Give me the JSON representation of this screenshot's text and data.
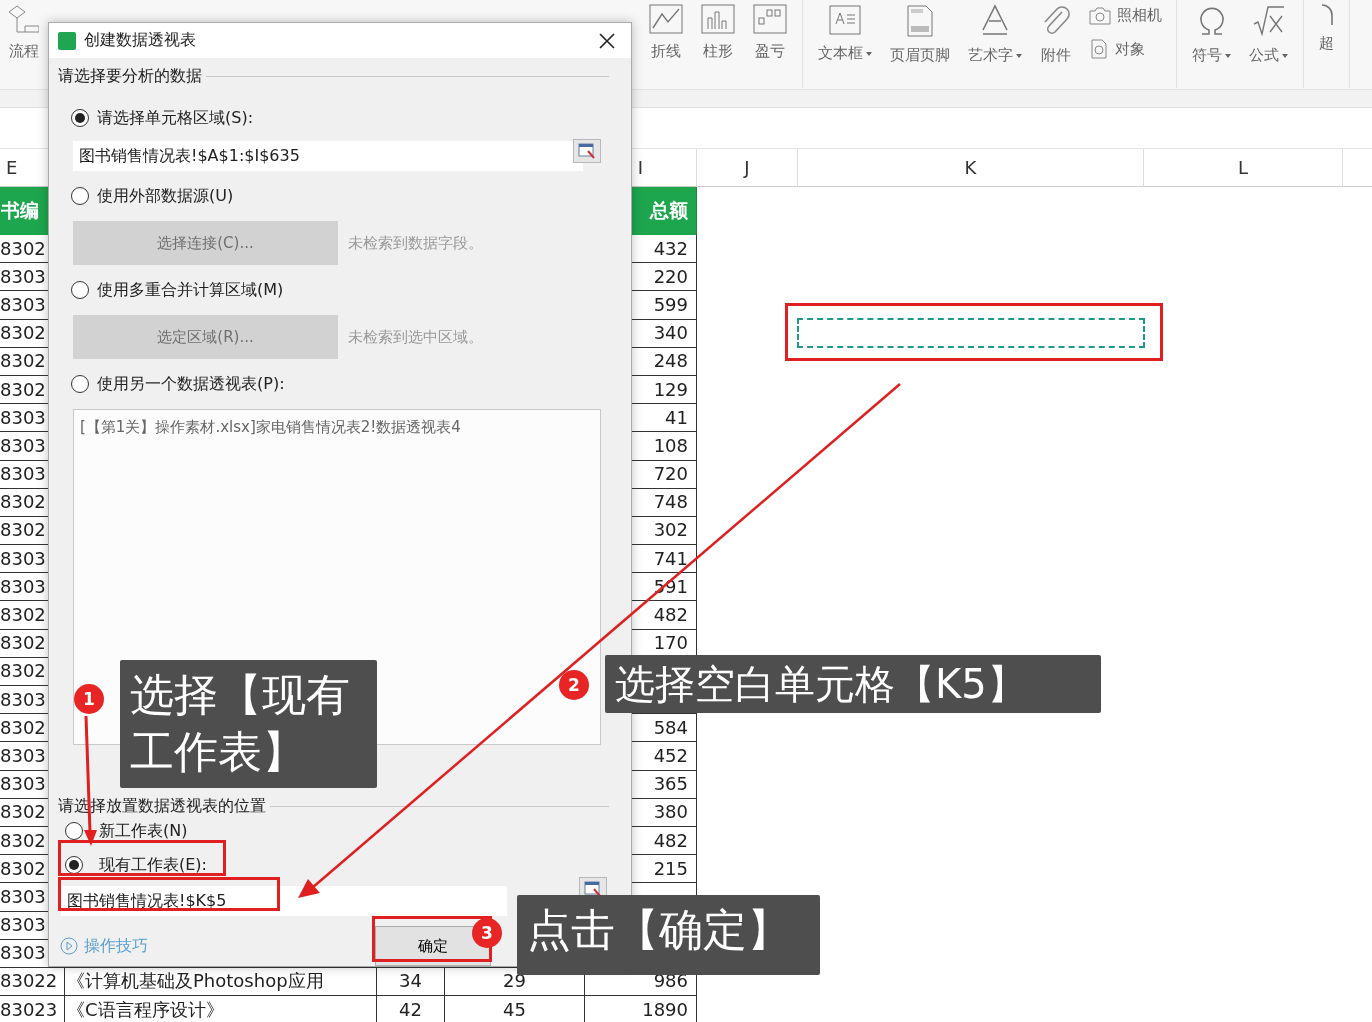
{
  "ribbon": {
    "left_items": [
      {
        "label": "流程"
      }
    ],
    "groups": [
      {
        "items": [
          {
            "kind": "large",
            "label": "折线"
          },
          {
            "kind": "large",
            "label": "柱形"
          },
          {
            "kind": "large",
            "label": "盈亏"
          }
        ]
      },
      {
        "items": [
          {
            "kind": "large",
            "label": "文本框",
            "dropdown": true
          },
          {
            "kind": "large",
            "label": "页眉页脚"
          },
          {
            "kind": "large",
            "label": "艺术字",
            "dropdown": true
          },
          {
            "kind": "large",
            "label": "附件"
          },
          {
            "kind": "stack",
            "entries": [
              {
                "label": "照相机"
              },
              {
                "label": "对象"
              }
            ]
          }
        ]
      },
      {
        "items": [
          {
            "kind": "large",
            "label": "符号",
            "dropdown": true
          },
          {
            "kind": "large",
            "label": "公式",
            "dropdown": true
          }
        ]
      },
      {
        "items": [
          {
            "kind": "large",
            "label": "超"
          }
        ]
      }
    ]
  },
  "sheet": {
    "column_headers": [
      "E",
      "I",
      "J",
      "K",
      "L"
    ],
    "header_cells": {
      "book_id": "书编",
      "total": "总额"
    },
    "rows": [
      {
        "book_id": "8302",
        "total": "432"
      },
      {
        "book_id": "8303",
        "total": "220"
      },
      {
        "book_id": "8303",
        "total": "599"
      },
      {
        "book_id": "8302",
        "total": "340"
      },
      {
        "book_id": "8302",
        "total": "248"
      },
      {
        "book_id": "8302",
        "total": "129"
      },
      {
        "book_id": "8303",
        "total": "41"
      },
      {
        "book_id": "8303",
        "total": "108"
      },
      {
        "book_id": "8303",
        "total": "720"
      },
      {
        "book_id": "8302",
        "total": "748"
      },
      {
        "book_id": "8302",
        "total": "302"
      },
      {
        "book_id": "8303",
        "total": "741"
      },
      {
        "book_id": "8303",
        "total": "591"
      },
      {
        "book_id": "8302",
        "total": "482"
      },
      {
        "book_id": "8302",
        "total": "170"
      },
      {
        "book_id": "8302"
      },
      {
        "book_id": "8303"
      },
      {
        "book_id": "8302",
        "total": "584"
      },
      {
        "book_id": "8303",
        "total": "452"
      },
      {
        "book_id": "8303",
        "total": "365"
      },
      {
        "book_id": "8302",
        "total": "380"
      },
      {
        "book_id": "8302",
        "total": "482"
      },
      {
        "book_id": "8302",
        "total": "215"
      },
      {
        "book_id": "8303"
      },
      {
        "book_id": "8303"
      },
      {
        "book_id": "8303"
      },
      {
        "book_id": "83022",
        "title": "《计算机基础及Photoshop应用",
        "column_g": "34",
        "column_h": "29",
        "total": "986"
      },
      {
        "book_id": "83023",
        "title": "《C语言程序设计》",
        "column_g": "42",
        "column_h": "45",
        "total": "1890"
      }
    ]
  },
  "dialog": {
    "title": "创建数据透视表",
    "source_section": {
      "label": "请选择要分析的数据",
      "options": [
        {
          "kind": "range",
          "label": "请选择单元格区域(S):",
          "selected": true,
          "value": "图书销售情况表!$A$1:$I$635"
        },
        {
          "kind": "connection",
          "label": "使用外部数据源(U)",
          "selected": false,
          "button": "选择连接(C)...",
          "disabled": true,
          "note": "未检索到数据字段。"
        },
        {
          "kind": "connection",
          "label": "使用多重合并计算区域(M)",
          "selected": false,
          "button": "选定区域(R)...",
          "disabled": true,
          "note": "未检索到选中区域。"
        },
        {
          "kind": "list",
          "label": "使用另一个数据透视表(P):",
          "selected": false,
          "items": [
            "[【第1关】操作素材.xlsx]家电销售情况表2!数据透视表4"
          ]
        }
      ]
    },
    "placement_section": {
      "label": "请选择放置数据透视表的位置",
      "options": [
        {
          "kind": "plain",
          "label": "新工作表(N)",
          "selected": false
        },
        {
          "kind": "range",
          "label": "现有工作表(E):",
          "selected": true,
          "value": "图书销售情况表!$K$5"
        }
      ]
    },
    "tips_link": "操作技巧",
    "ok_button": "确定"
  },
  "annotations": [
    {
      "number": "1",
      "text": "选择【现有工作表】"
    },
    {
      "number": "2",
      "text": "选择空白单元格【K5】"
    },
    {
      "number": "3",
      "text": "点击【确定】"
    }
  ]
}
